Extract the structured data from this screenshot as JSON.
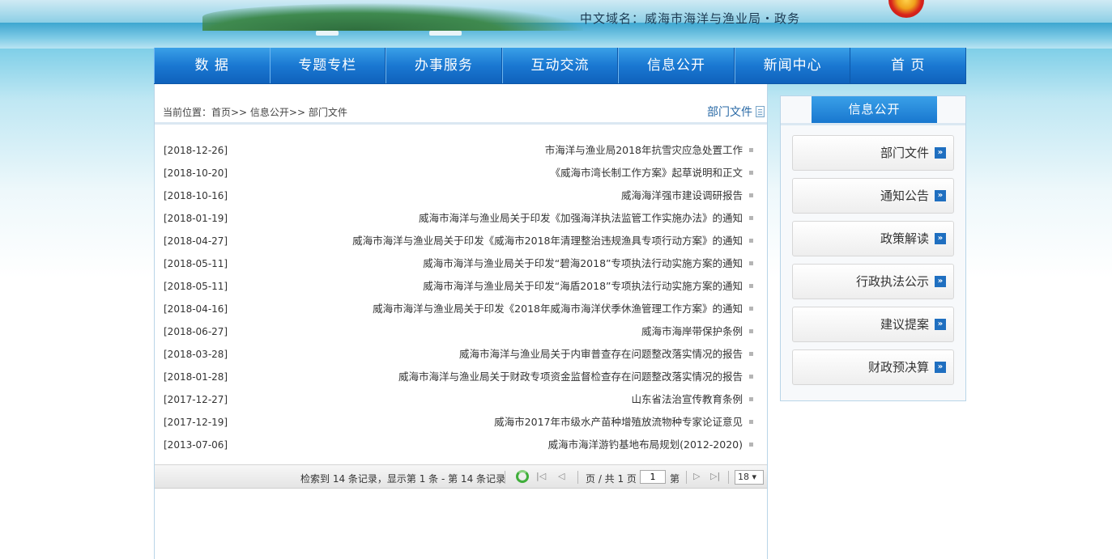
{
  "header": {
    "site_name": "中文域名：威海市海洋与渔业局・政务"
  },
  "nav": {
    "items": [
      "首 页",
      "新闻中心",
      "信息公开",
      "互动交流",
      "办事服务",
      "专题专栏",
      "数 据"
    ]
  },
  "main": {
    "section_title": "部门文件",
    "breadcrumb": "当前位置：首页>> 信息公开>> 部门文件",
    "documents": [
      {
        "title": "市海洋与渔业局2018年抗雪灾应急处置工作",
        "date": "[2018-12-26]"
      },
      {
        "title": "《威海市湾长制工作方案》起草说明和正文",
        "date": "[2018-10-20]"
      },
      {
        "title": "威海海洋强市建设调研报告",
        "date": "[2018-10-16]"
      },
      {
        "title": "威海市海洋与渔业局关于印发《加强海洋执法监管工作实施办法》的通知",
        "date": "[2018-01-19]"
      },
      {
        "title": "威海市海洋与渔业局关于印发《威海市2018年清理整治违规渔具专项行动方案》的通知",
        "date": "[2018-04-27]"
      },
      {
        "title": "威海市海洋与渔业局关于印发“碧海2018”专项执法行动实施方案的通知",
        "date": "[2018-05-11]"
      },
      {
        "title": "威海市海洋与渔业局关于印发“海盾2018”专项执法行动实施方案的通知",
        "date": "[2018-05-11]"
      },
      {
        "title": "威海市海洋与渔业局关于印发《2018年威海市海洋伏季休渔管理工作方案》的通知",
        "date": "[2018-04-16]"
      },
      {
        "title": "威海市海岸带保护条例",
        "date": "[2018-06-27]"
      },
      {
        "title": "威海市海洋与渔业局关于内审普查存在问题整改落实情况的报告",
        "date": "[2018-03-28]"
      },
      {
        "title": "威海市海洋与渔业局关于财政专项资金监督检查存在问题整改落实情况的报告",
        "date": "[2018-01-28]"
      },
      {
        "title": "山东省法治宣传教育条例",
        "date": "[2017-12-27]"
      },
      {
        "title": "威海市2017年市级水产苗种增殖放流物种专家论证意见",
        "date": "[2017-12-19]"
      },
      {
        "title": "威海市海洋游钓基地布局规划(2012-2020)",
        "date": "[2013-07-06]"
      }
    ]
  },
  "pager": {
    "info": "检索到 14 条记录，显示第 1 条 - 第 14 条记录",
    "page_label": "第",
    "current_page": "1",
    "total_label": "页 / 共 1 页",
    "page_size": "18 ▾",
    "first_icon": "|◁",
    "prev_icon": "◁",
    "next_icon": "▷",
    "last_icon": "▷|"
  },
  "sidebar": {
    "tab_label": "信息公开",
    "items": [
      "部门文件",
      "通知公告",
      "政策解读",
      "行政执法公示",
      "建议提案",
      "财政预决算"
    ],
    "icon": "double-chevron-icon"
  }
}
